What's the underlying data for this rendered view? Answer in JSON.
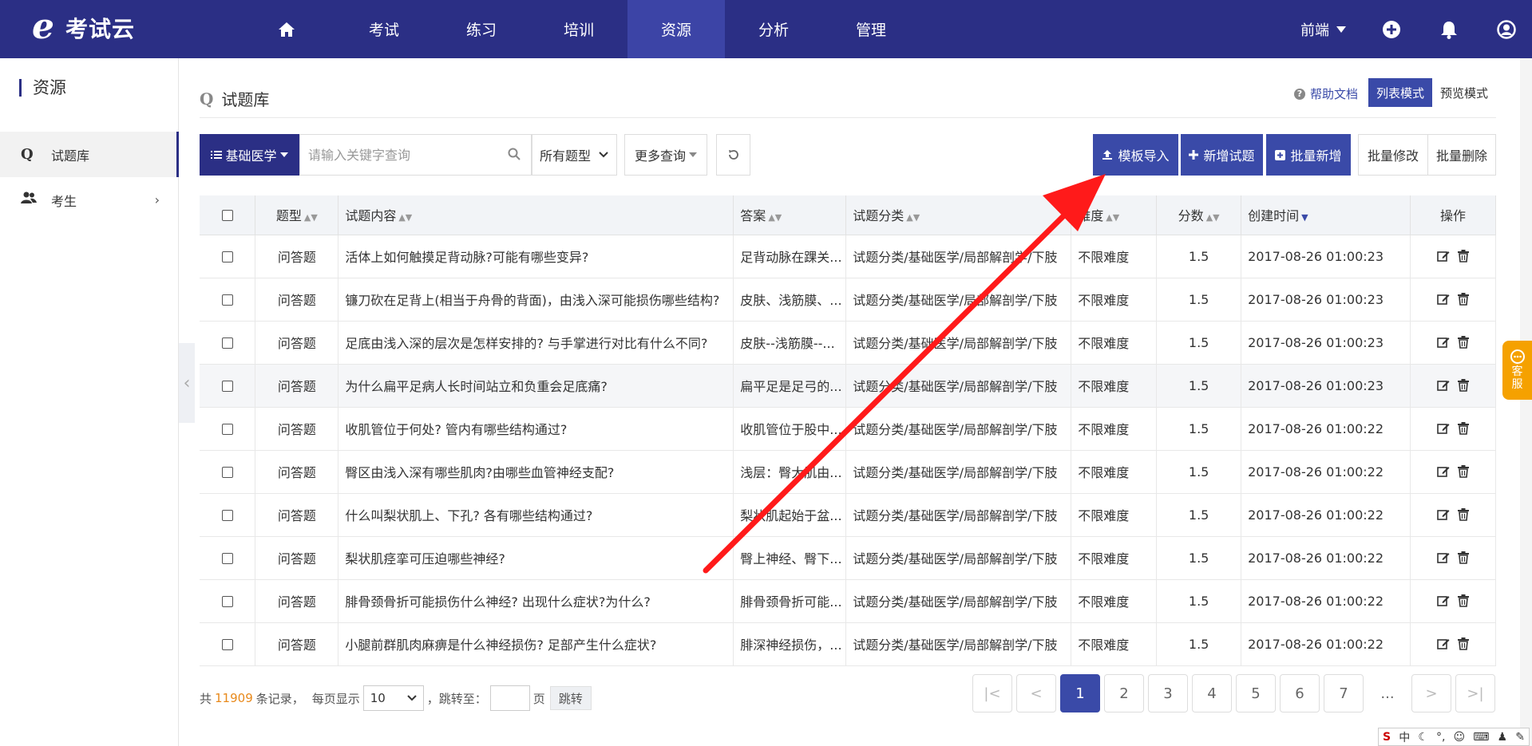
{
  "app": {
    "logo_mark": "e",
    "logo_text": "考试云"
  },
  "nav": {
    "items": [
      {
        "label": "",
        "icon": "home-icon"
      },
      {
        "label": "考试"
      },
      {
        "label": "练习"
      },
      {
        "label": "培训"
      },
      {
        "label": "资源"
      },
      {
        "label": "分析"
      },
      {
        "label": "管理"
      }
    ],
    "user": "前端"
  },
  "sidebar": {
    "title": "资源",
    "items": [
      {
        "label": "试题库",
        "icon": "question-bank-icon"
      },
      {
        "label": "考生",
        "icon": "users-icon"
      }
    ]
  },
  "page": {
    "title": "试题库",
    "help": "帮助文档",
    "mode_list": "列表模式",
    "mode_preview": "预览模式"
  },
  "toolbar": {
    "category": "基础医学",
    "search_placeholder": "请输入关键字查询",
    "type_filter": "所有题型",
    "more_query": "更多查询",
    "import": "模板导入",
    "add": "新增试题",
    "batch_add": "批量新增",
    "batch_edit": "批量修改",
    "batch_delete": "批量删除"
  },
  "table": {
    "headers": [
      "题型",
      "试题内容",
      "答案",
      "试题分类",
      "难度",
      "分数",
      "创建时间",
      "操作"
    ],
    "rows": [
      {
        "type": "问答题",
        "content": "活体上如何触摸足背动脉?可能有哪些变异?",
        "answer": "足背动脉在踝关...",
        "category": "试题分类/基础医学/局部解剖学/下肢",
        "difficulty": "不限难度",
        "score": "1.5",
        "created": "2017-08-26 01:00:23"
      },
      {
        "type": "问答题",
        "content": "镰刀砍在足背上(相当于舟骨的背面)，由浅入深可能损伤哪些结构?",
        "answer": "皮肤、浅筋膜、...",
        "category": "试题分类/基础医学/局部解剖学/下肢",
        "difficulty": "不限难度",
        "score": "1.5",
        "created": "2017-08-26 01:00:23"
      },
      {
        "type": "问答题",
        "content": "足底由浅入深的层次是怎样安排的? 与手掌进行对比有什么不同?",
        "answer": "皮肤--浅筋膜--...",
        "category": "试题分类/基础医学/局部解剖学/下肢",
        "difficulty": "不限难度",
        "score": "1.5",
        "created": "2017-08-26 01:00:23"
      },
      {
        "type": "问答题",
        "content": "为什么扁平足病人长时间站立和负重会足底痛?",
        "answer": "扁平足是足弓的...",
        "category": "试题分类/基础医学/局部解剖学/下肢",
        "difficulty": "不限难度",
        "score": "1.5",
        "created": "2017-08-26 01:00:23"
      },
      {
        "type": "问答题",
        "content": "收肌管位于何处? 管内有哪些结构通过?",
        "answer": "收肌管位于股中...",
        "category": "试题分类/基础医学/局部解剖学/下肢",
        "difficulty": "不限难度",
        "score": "1.5",
        "created": "2017-08-26 01:00:22"
      },
      {
        "type": "问答题",
        "content": "臀区由浅入深有哪些肌肉?由哪些血管神经支配?",
        "answer": "浅层：臀大肌由...",
        "category": "试题分类/基础医学/局部解剖学/下肢",
        "difficulty": "不限难度",
        "score": "1.5",
        "created": "2017-08-26 01:00:22"
      },
      {
        "type": "问答题",
        "content": "什么叫梨状肌上、下孔? 各有哪些结构通过?",
        "answer": "梨状肌起始于盆...",
        "category": "试题分类/基础医学/局部解剖学/下肢",
        "difficulty": "不限难度",
        "score": "1.5",
        "created": "2017-08-26 01:00:22"
      },
      {
        "type": "问答题",
        "content": "梨状肌痉挛可压迫哪些神经?",
        "answer": "臀上神经、臀下...",
        "category": "试题分类/基础医学/局部解剖学/下肢",
        "difficulty": "不限难度",
        "score": "1.5",
        "created": "2017-08-26 01:00:22"
      },
      {
        "type": "问答题",
        "content": "腓骨颈骨折可能损伤什么神经? 出现什么症状?为什么?",
        "answer": "腓骨颈骨折可能...",
        "category": "试题分类/基础医学/局部解剖学/下肢",
        "difficulty": "不限难度",
        "score": "1.5",
        "created": "2017-08-26 01:00:22"
      },
      {
        "type": "问答题",
        "content": "小腿前群肌肉麻痹是什么神经损伤? 足部产生什么症状?",
        "answer": "腓深神经损伤，...",
        "category": "试题分类/基础医学/局部解剖学/下肢",
        "difficulty": "不限难度",
        "score": "1.5",
        "created": "2017-08-26 01:00:22"
      }
    ]
  },
  "footer": {
    "prefix": "共",
    "total": "11909",
    "suffix": "条记录，",
    "per_page_label": "每页显示",
    "per_page": "10",
    "jump_label": "，跳转至：",
    "page_unit": "页",
    "jump_btn": "跳转"
  },
  "pager": {
    "first": "|<",
    "prev": "<",
    "pages": [
      "1",
      "2",
      "3",
      "4",
      "5",
      "6",
      "7"
    ],
    "ellipsis": "...",
    "next": ">",
    "last": ">|"
  },
  "kefu": {
    "line1": "客",
    "line2": "服"
  },
  "ime": {
    "label": "中"
  },
  "colors": {
    "nav_bg": "#2b2f85",
    "accent": "#3a4aa8",
    "total": "#e8891b",
    "kefu": "#f5a100",
    "arrow": "#ff1a1a"
  }
}
